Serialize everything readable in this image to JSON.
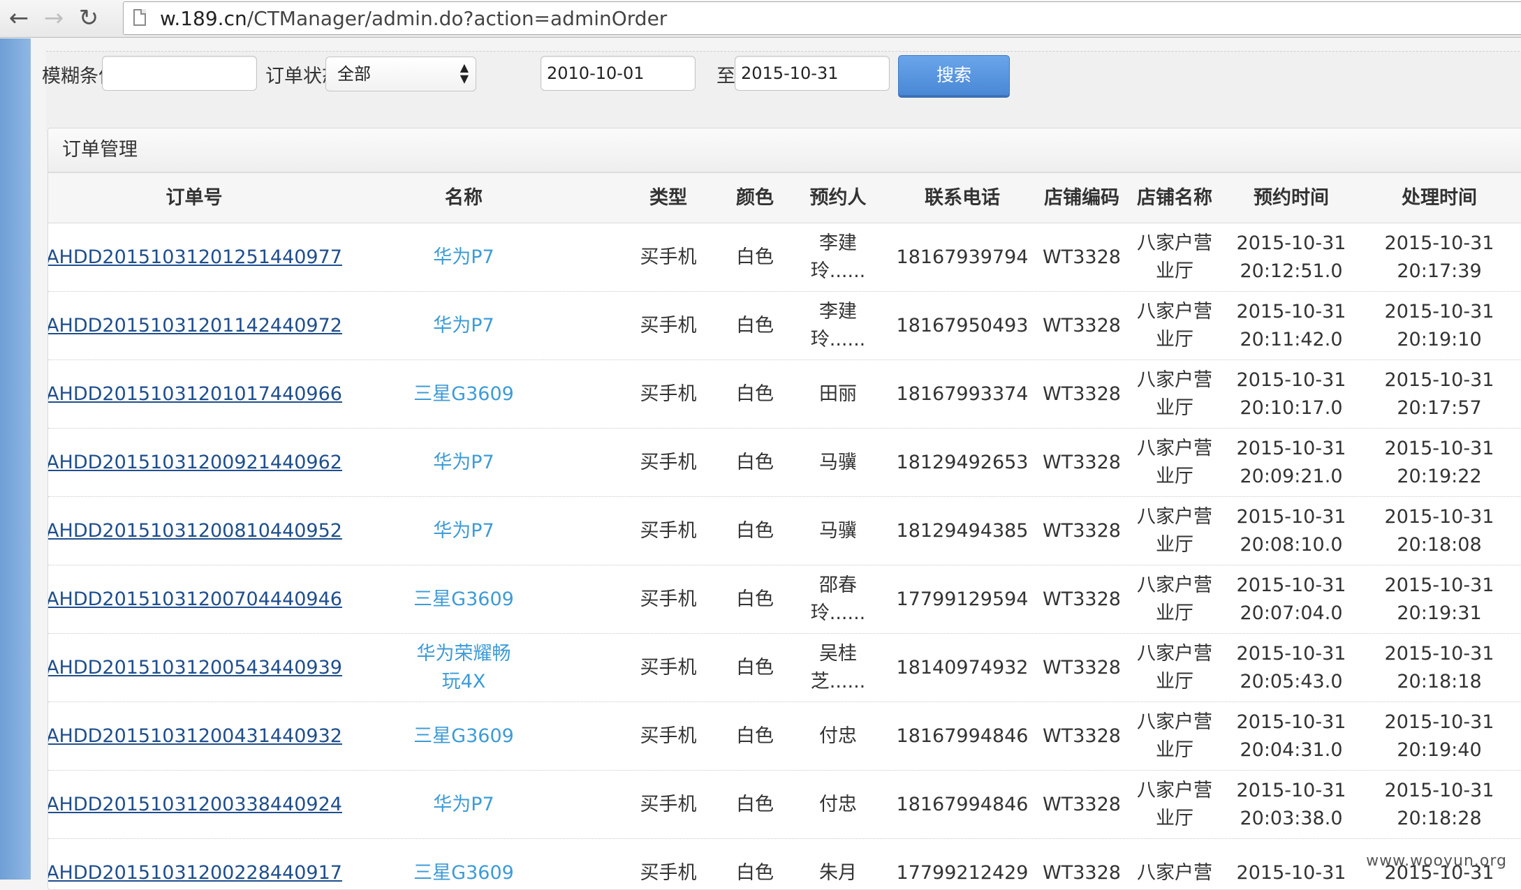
{
  "browser": {
    "url_domain": "w.189.cn",
    "url_path": "/CTManager/admin.do?action=adminOrder"
  },
  "filters": {
    "fuzzy_label": "模糊条件",
    "fuzzy_value": "",
    "status_label": "订单状态",
    "status_value": "全部",
    "date_from": "2010-10-01",
    "date_to_label": "至",
    "date_to": "2015-10-31",
    "search_label": "搜索"
  },
  "panel": {
    "title": "订单管理"
  },
  "table": {
    "headers": [
      "订单号",
      "名称",
      "类型",
      "颜色",
      "预约人",
      "联系电话",
      "店铺编码",
      "店铺名称",
      "预约时间",
      "处理时间"
    ],
    "rows": [
      {
        "order": "AHDD20151031201251440977",
        "name": "华为P7",
        "type": "买手机",
        "color": "白色",
        "booker": [
          "李建",
          "玲......"
        ],
        "phone": "18167939794",
        "store_code": "WT3328",
        "store_name": [
          "八家户营",
          "业厅"
        ],
        "book_time": [
          "2015-10-31",
          "20:12:51.0"
        ],
        "process_time": [
          "2015-10-31",
          "20:17:39"
        ]
      },
      {
        "order": "AHDD20151031201142440972",
        "name": "华为P7",
        "type": "买手机",
        "color": "白色",
        "booker": [
          "李建",
          "玲......"
        ],
        "phone": "18167950493",
        "store_code": "WT3328",
        "store_name": [
          "八家户营",
          "业厅"
        ],
        "book_time": [
          "2015-10-31",
          "20:11:42.0"
        ],
        "process_time": [
          "2015-10-31",
          "20:19:10"
        ]
      },
      {
        "order": "AHDD20151031201017440966",
        "name": "三星G3609",
        "type": "买手机",
        "color": "白色",
        "booker": [
          "田丽"
        ],
        "phone": "18167993374",
        "store_code": "WT3328",
        "store_name": [
          "八家户营",
          "业厅"
        ],
        "book_time": [
          "2015-10-31",
          "20:10:17.0"
        ],
        "process_time": [
          "2015-10-31",
          "20:17:57"
        ]
      },
      {
        "order": "AHDD20151031200921440962",
        "name": "华为P7",
        "type": "买手机",
        "color": "白色",
        "booker": [
          "马骥"
        ],
        "phone": "18129492653",
        "store_code": "WT3328",
        "store_name": [
          "八家户营",
          "业厅"
        ],
        "book_time": [
          "2015-10-31",
          "20:09:21.0"
        ],
        "process_time": [
          "2015-10-31",
          "20:19:22"
        ]
      },
      {
        "order": "AHDD20151031200810440952",
        "name": "华为P7",
        "type": "买手机",
        "color": "白色",
        "booker": [
          "马骥"
        ],
        "phone": "18129494385",
        "store_code": "WT3328",
        "store_name": [
          "八家户营",
          "业厅"
        ],
        "book_time": [
          "2015-10-31",
          "20:08:10.0"
        ],
        "process_time": [
          "2015-10-31",
          "20:18:08"
        ]
      },
      {
        "order": "AHDD20151031200704440946",
        "name": "三星G3609",
        "type": "买手机",
        "color": "白色",
        "booker": [
          "邵春",
          "玲......"
        ],
        "phone": "17799129594",
        "store_code": "WT3328",
        "store_name": [
          "八家户营",
          "业厅"
        ],
        "book_time": [
          "2015-10-31",
          "20:07:04.0"
        ],
        "process_time": [
          "2015-10-31",
          "20:19:31"
        ]
      },
      {
        "order": "AHDD20151031200543440939",
        "name": "华为荣耀畅玩4X",
        "type": "买手机",
        "color": "白色",
        "booker": [
          "吴桂",
          "芝......"
        ],
        "phone": "18140974932",
        "store_code": "WT3328",
        "store_name": [
          "八家户营",
          "业厅"
        ],
        "book_time": [
          "2015-10-31",
          "20:05:43.0"
        ],
        "process_time": [
          "2015-10-31",
          "20:18:18"
        ]
      },
      {
        "order": "AHDD20151031200431440932",
        "name": "三星G3609",
        "type": "买手机",
        "color": "白色",
        "booker": [
          "付忠"
        ],
        "phone": "18167994846",
        "store_code": "WT3328",
        "store_name": [
          "八家户营",
          "业厅"
        ],
        "book_time": [
          "2015-10-31",
          "20:04:31.0"
        ],
        "process_time": [
          "2015-10-31",
          "20:19:40"
        ]
      },
      {
        "order": "AHDD20151031200338440924",
        "name": "华为P7",
        "type": "买手机",
        "color": "白色",
        "booker": [
          "付忠"
        ],
        "phone": "18167994846",
        "store_code": "WT3328",
        "store_name": [
          "八家户营",
          "业厅"
        ],
        "book_time": [
          "2015-10-31",
          "20:03:38.0"
        ],
        "process_time": [
          "2015-10-31",
          "20:18:28"
        ]
      },
      {
        "order": "AHDD20151031200228440917",
        "name": "三星G3609",
        "type": "买手机",
        "color": "白色",
        "booker": [
          "朱月"
        ],
        "phone": "17799212429",
        "store_code": "WT3328",
        "store_name": [
          "八家户营"
        ],
        "book_time": [
          "2015-10-31"
        ],
        "process_time": [
          "2015-10-31"
        ]
      }
    ]
  },
  "watermark": "www.wooyun.org",
  "icons": {
    "back": "back-arrow-icon",
    "forward": "forward-arrow-icon",
    "reload": "reload-icon",
    "page": "page-icon",
    "select": "select-arrows-icon"
  }
}
